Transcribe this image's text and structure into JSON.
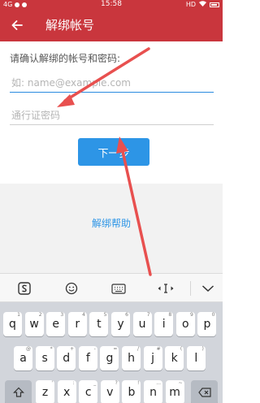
{
  "status_bar": {
    "network": "4G",
    "time": "15:58",
    "right": "HD"
  },
  "header": {
    "title": "解绑帐号",
    "back_icon": "arrow-left-icon"
  },
  "form": {
    "prompt": "请确认解绑的帐号和密码:",
    "email_placeholder": "如: name@example.com",
    "password_placeholder": "通行证密码",
    "next_label": "下一步"
  },
  "help": {
    "link_label": "解绑帮助"
  },
  "keyboard_toolbar": {
    "items": [
      "sogou-logo-icon",
      "emoji-icon",
      "keyboard-icon",
      "cursor-move-icon",
      "collapse-chevron-icon"
    ]
  },
  "keyboard": {
    "row1": [
      {
        "k": "q",
        "s": "1"
      },
      {
        "k": "w",
        "s": "2"
      },
      {
        "k": "e",
        "s": "3"
      },
      {
        "k": "r",
        "s": "4"
      },
      {
        "k": "t",
        "s": "5"
      },
      {
        "k": "y",
        "s": "6"
      },
      {
        "k": "u",
        "s": "7"
      },
      {
        "k": "i",
        "s": "8"
      },
      {
        "k": "o",
        "s": "9"
      },
      {
        "k": "p",
        "s": "0"
      }
    ],
    "row2": [
      {
        "k": "a",
        "s": "@"
      },
      {
        "k": "s",
        "s": "*"
      },
      {
        "k": "d",
        "s": "+"
      },
      {
        "k": "f",
        "s": "-"
      },
      {
        "k": "g",
        "s": "="
      },
      {
        "k": "h",
        "s": "/"
      },
      {
        "k": "j",
        "s": "#"
      },
      {
        "k": "k",
        "s": "("
      },
      {
        "k": "l",
        "s": ")"
      }
    ],
    "row3": [
      {
        "k": "z",
        "s": "'"
      },
      {
        "k": "x",
        "s": ":"
      },
      {
        "k": "c",
        "s": "_"
      },
      {
        "k": "v",
        "s": "?"
      },
      {
        "k": "b",
        "s": "!"
      },
      {
        "k": "n",
        "s": "..."
      },
      {
        "k": "m",
        "s": "~"
      }
    ],
    "shift_icon": "shift-icon",
    "delete_icon": "backspace-icon"
  },
  "colors": {
    "header": "#c9363d",
    "primary": "#2d95e6",
    "annotation": "#e8504f"
  }
}
